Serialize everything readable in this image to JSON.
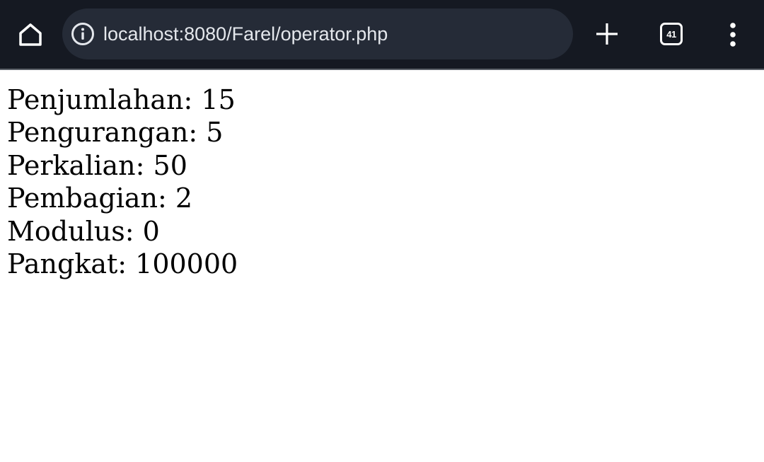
{
  "browser": {
    "url": "localhost:8080/Farel/operator.php",
    "tab_count": "41",
    "icons": {
      "home": "home-icon",
      "site_info": "info-icon",
      "new_tab": "plus-icon",
      "tabs": "tab-switcher-icon",
      "menu": "more-vertical-icon"
    },
    "colors": {
      "toolbar_bg": "#151922",
      "url_bar_bg": "#252b37",
      "url_text": "#e4e7ec"
    }
  },
  "page": {
    "lines": [
      "Penjumlahan: 15",
      "Pengurangan: 5",
      "Perkalian: 50",
      "Pembagian: 2",
      "Modulus: 0",
      "Pangkat: 100000"
    ]
  }
}
